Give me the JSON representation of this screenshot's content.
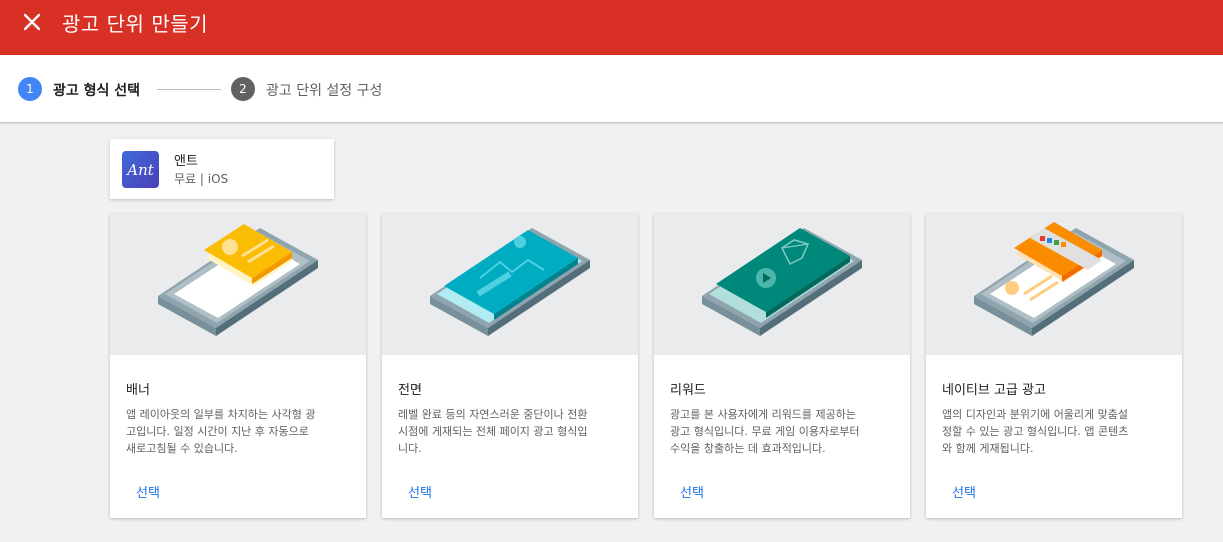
{
  "header": {
    "title": "광고 단위 만들기",
    "close_icon": "close-icon"
  },
  "stepper": {
    "steps": [
      {
        "number": "1",
        "label": "광고 형식 선택",
        "state": "active",
        "color": "#4285f4"
      },
      {
        "number": "2",
        "label": "광고 단위 설정 구성",
        "state": "inactive",
        "color": "#616161"
      }
    ]
  },
  "app": {
    "icon_text": "Ant",
    "name": "앤트",
    "subtitle": "무료 | iOS"
  },
  "formats": [
    {
      "name": "배너",
      "illustration": "banner-illustration",
      "description": "앱 레이아웃의 일부를 차지하는 사각형 광\n고입니다. 일정 시간이 지난 후 자동으로\n새로고침될 수 있습니다.",
      "action": "선택"
    },
    {
      "name": "전면",
      "illustration": "interstitial-illustration",
      "description": "레벨 완료 등의 자연스러운 중단이나 전환\n시점에 게재되는 전체 페이지 광고 형식입\n니다.",
      "action": "선택"
    },
    {
      "name": "리워드",
      "illustration": "rewarded-illustration",
      "description": "광고를 본 사용자에게 리워드를 제공하는\n광고 형식입니다. 무료 게임 이용자로부터\n수익을 창출하는 데 효과적입니다.",
      "action": "선택"
    },
    {
      "name": "네이티브 고급 광고",
      "illustration": "native-illustration",
      "description": "앱의 디자인과 분위기에 어울리게 맞춤설\n정할 수 있는 광고 형식입니다. 앱 콘텐츠\n와 함께 게재됩니다.",
      "action": "선택"
    }
  ],
  "colors": {
    "header": "#d93025",
    "link": "#1a73e8",
    "banner": "#fbbc04",
    "interstitial": "#00acc1",
    "rewarded": "#00897b",
    "native": "#fb8c00"
  }
}
